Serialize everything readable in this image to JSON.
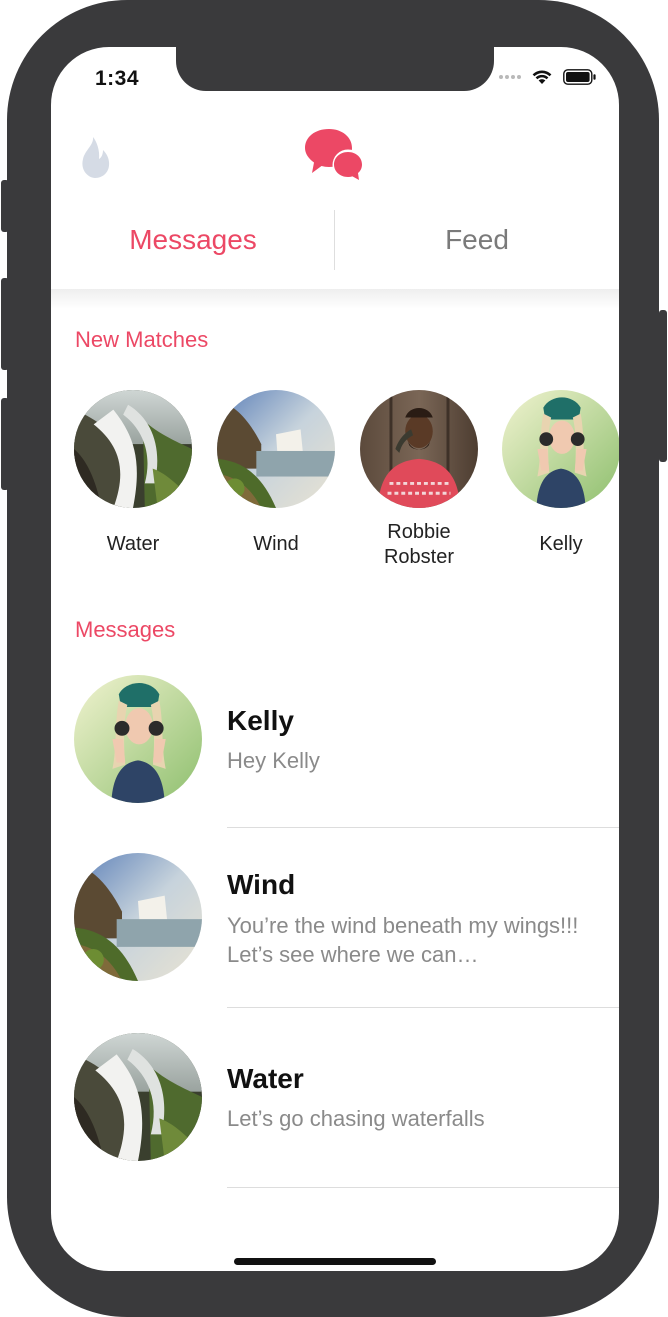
{
  "status_bar": {
    "time": "1:34"
  },
  "header": {
    "left_icon": "flame-icon",
    "center_icon": "chat-bubbles-icon"
  },
  "tabs": [
    {
      "label": "Messages",
      "active": true
    },
    {
      "label": "Feed",
      "active": false
    }
  ],
  "new_matches": {
    "title": "New Matches",
    "items": [
      {
        "name": "Water",
        "image": "waterfall-photo"
      },
      {
        "name": "Wind",
        "image": "landscape-waterfall-photo"
      },
      {
        "name": "Robbie\nRobster",
        "image": "man-portrait-photo"
      },
      {
        "name": "Kelly",
        "image": "woman-headphones-photo"
      }
    ]
  },
  "messages": {
    "title": "Messages",
    "items": [
      {
        "name": "Kelly",
        "preview": "Hey Kelly",
        "image": "woman-headphones-photo"
      },
      {
        "name": "Wind",
        "preview": "You’re the wind beneath my wings!!! Let’s see where we can…",
        "image": "landscape-waterfall-photo"
      },
      {
        "name": "Water",
        "preview": "Let’s go chasing waterfalls",
        "image": "waterfall-photo"
      }
    ]
  },
  "colors": {
    "accent": "#ec4865",
    "frame": "#3a3a3c",
    "muted": "#8a8a8a",
    "flame": "#d5dbe5"
  }
}
